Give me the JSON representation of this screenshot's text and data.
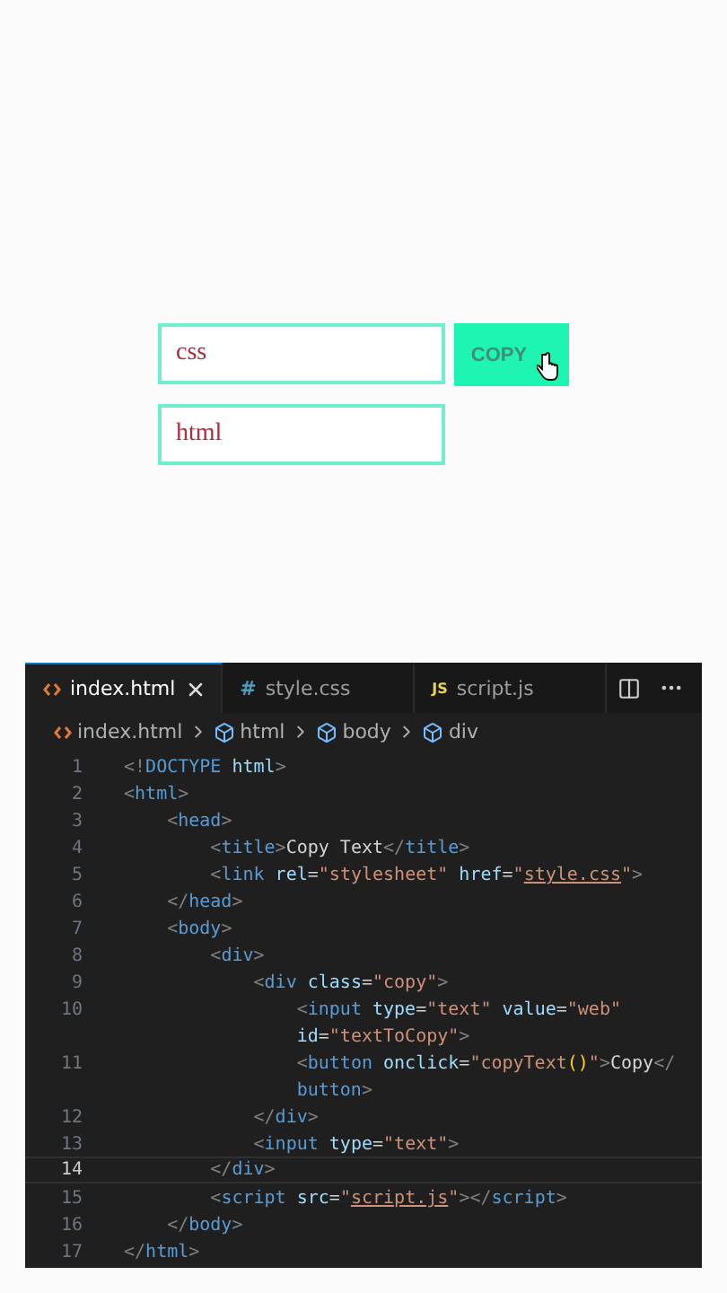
{
  "preview": {
    "inputs": [
      {
        "value": "css"
      },
      {
        "value": "html"
      }
    ],
    "button": {
      "label": "COPY"
    }
  },
  "editor": {
    "tabs": [
      {
        "label": "index.html",
        "kind": "html",
        "selected": true,
        "closable": true
      },
      {
        "label": "style.css",
        "kind": "css",
        "badge": "#",
        "selected": false,
        "closable": false
      },
      {
        "label": "script.js",
        "kind": "js",
        "badge": "JS",
        "selected": false,
        "closable": false
      }
    ],
    "breadcrumbs": [
      {
        "label": "index.html",
        "kind": "file"
      },
      {
        "label": "html",
        "kind": "element"
      },
      {
        "label": "body",
        "kind": "element"
      },
      {
        "label": "div",
        "kind": "element"
      }
    ],
    "lines": [
      {
        "number": "1",
        "current": false,
        "rows": [
          {
            "tokens": [
              {
                "kind": "punct",
                "text": "<!"
              },
              {
                "kind": "tag",
                "text": "DOCTYPE"
              },
              {
                "kind": "attr",
                "text": " html"
              },
              {
                "kind": "punct",
                "text": ">"
              }
            ]
          }
        ]
      },
      {
        "number": "2",
        "current": false,
        "rows": [
          {
            "tokens": [
              {
                "kind": "punct",
                "text": "<"
              },
              {
                "kind": "tag",
                "text": "html"
              },
              {
                "kind": "punct",
                "text": ">"
              }
            ]
          }
        ]
      },
      {
        "number": "3",
        "current": false,
        "rows": [
          {
            "tokens": [
              {
                "kind": "punct",
                "text": "    <"
              },
              {
                "kind": "tag",
                "text": "head"
              },
              {
                "kind": "punct",
                "text": ">"
              }
            ]
          }
        ]
      },
      {
        "number": "4",
        "current": false,
        "rows": [
          {
            "tokens": [
              {
                "kind": "punct",
                "text": "        <"
              },
              {
                "kind": "tag",
                "text": "title"
              },
              {
                "kind": "punct",
                "text": ">"
              },
              {
                "kind": "plain",
                "text": "Copy Text"
              },
              {
                "kind": "punct",
                "text": "</"
              },
              {
                "kind": "tag",
                "text": "title"
              },
              {
                "kind": "punct",
                "text": ">"
              }
            ]
          }
        ]
      },
      {
        "number": "5",
        "current": false,
        "rows": [
          {
            "tokens": [
              {
                "kind": "punct",
                "text": "        <"
              },
              {
                "kind": "tag",
                "text": "link"
              },
              {
                "kind": "attr",
                "text": " rel"
              },
              {
                "kind": "plain",
                "text": "="
              },
              {
                "kind": "string",
                "text": "\"stylesheet\""
              },
              {
                "kind": "attr",
                "text": " href"
              },
              {
                "kind": "plain",
                "text": "="
              },
              {
                "kind": "string",
                "text": "\""
              },
              {
                "kind": "link",
                "text": "style.css"
              },
              {
                "kind": "string",
                "text": "\""
              },
              {
                "kind": "punct",
                "text": ">"
              }
            ]
          }
        ]
      },
      {
        "number": "6",
        "current": false,
        "rows": [
          {
            "tokens": [
              {
                "kind": "punct",
                "text": "    </"
              },
              {
                "kind": "tag",
                "text": "head"
              },
              {
                "kind": "punct",
                "text": ">"
              }
            ]
          }
        ]
      },
      {
        "number": "7",
        "current": false,
        "rows": [
          {
            "tokens": [
              {
                "kind": "punct",
                "text": "    <"
              },
              {
                "kind": "tag",
                "text": "body"
              },
              {
                "kind": "punct",
                "text": ">"
              }
            ]
          }
        ]
      },
      {
        "number": "8",
        "current": false,
        "rows": [
          {
            "tokens": [
              {
                "kind": "punct",
                "text": "        <"
              },
              {
                "kind": "tag",
                "text": "div"
              },
              {
                "kind": "punct",
                "text": ">"
              }
            ]
          }
        ]
      },
      {
        "number": "9",
        "current": false,
        "rows": [
          {
            "tokens": [
              {
                "kind": "punct",
                "text": "            <"
              },
              {
                "kind": "tag",
                "text": "div"
              },
              {
                "kind": "attr",
                "text": " class"
              },
              {
                "kind": "plain",
                "text": "="
              },
              {
                "kind": "string",
                "text": "\"copy\""
              },
              {
                "kind": "punct",
                "text": ">"
              }
            ]
          }
        ]
      },
      {
        "number": "10",
        "current": false,
        "rows": [
          {
            "tokens": [
              {
                "kind": "punct",
                "text": "                <"
              },
              {
                "kind": "tag",
                "text": "input"
              },
              {
                "kind": "attr",
                "text": " type"
              },
              {
                "kind": "plain",
                "text": "="
              },
              {
                "kind": "string",
                "text": "\"text\""
              },
              {
                "kind": "attr",
                "text": " value"
              },
              {
                "kind": "plain",
                "text": "="
              },
              {
                "kind": "string",
                "text": "\"web\""
              }
            ]
          },
          {
            "tokens": [
              {
                "kind": "attr",
                "text": "                id"
              },
              {
                "kind": "plain",
                "text": "="
              },
              {
                "kind": "string",
                "text": "\"textToCopy\""
              },
              {
                "kind": "punct",
                "text": ">"
              }
            ]
          }
        ]
      },
      {
        "number": "11",
        "current": false,
        "rows": [
          {
            "tokens": [
              {
                "kind": "punct",
                "text": "                <"
              },
              {
                "kind": "tag",
                "text": "button"
              },
              {
                "kind": "attr",
                "text": " onclick"
              },
              {
                "kind": "plain",
                "text": "="
              },
              {
                "kind": "string",
                "text": "\"copyText"
              },
              {
                "kind": "paren",
                "text": "()"
              },
              {
                "kind": "string",
                "text": "\""
              },
              {
                "kind": "punct",
                "text": ">"
              },
              {
                "kind": "plain",
                "text": "Copy"
              },
              {
                "kind": "punct",
                "text": "</"
              }
            ]
          },
          {
            "tokens": [
              {
                "kind": "tag",
                "text": "                button"
              },
              {
                "kind": "punct",
                "text": ">"
              }
            ]
          }
        ]
      },
      {
        "number": "12",
        "current": false,
        "rows": [
          {
            "tokens": [
              {
                "kind": "punct",
                "text": "            </"
              },
              {
                "kind": "tag",
                "text": "div"
              },
              {
                "kind": "punct",
                "text": ">"
              }
            ]
          }
        ]
      },
      {
        "number": "13",
        "current": false,
        "rows": [
          {
            "tokens": [
              {
                "kind": "punct",
                "text": "            <"
              },
              {
                "kind": "tag",
                "text": "input"
              },
              {
                "kind": "attr",
                "text": " type"
              },
              {
                "kind": "plain",
                "text": "="
              },
              {
                "kind": "string",
                "text": "\"text\""
              },
              {
                "kind": "punct",
                "text": ">"
              }
            ]
          }
        ]
      },
      {
        "number": "14",
        "current": true,
        "rows": [
          {
            "tokens": [
              {
                "kind": "punct",
                "text": "        </"
              },
              {
                "kind": "tag",
                "text": "div"
              },
              {
                "kind": "punct",
                "text": ">"
              }
            ]
          }
        ]
      },
      {
        "number": "15",
        "current": false,
        "rows": [
          {
            "tokens": [
              {
                "kind": "punct",
                "text": "        <"
              },
              {
                "kind": "tag",
                "text": "script"
              },
              {
                "kind": "attr",
                "text": " src"
              },
              {
                "kind": "plain",
                "text": "="
              },
              {
                "kind": "string",
                "text": "\""
              },
              {
                "kind": "link",
                "text": "script.js"
              },
              {
                "kind": "string",
                "text": "\""
              },
              {
                "kind": "punct",
                "text": "></"
              },
              {
                "kind": "tag",
                "text": "script"
              },
              {
                "kind": "punct",
                "text": ">"
              }
            ]
          }
        ]
      },
      {
        "number": "16",
        "current": false,
        "rows": [
          {
            "tokens": [
              {
                "kind": "punct",
                "text": "    </"
              },
              {
                "kind": "tag",
                "text": "body"
              },
              {
                "kind": "punct",
                "text": ">"
              }
            ]
          }
        ]
      },
      {
        "number": "17",
        "current": false,
        "rows": [
          {
            "tokens": [
              {
                "kind": "punct",
                "text": "</"
              },
              {
                "kind": "tag",
                "text": "html"
              },
              {
                "kind": "punct",
                "text": ">"
              }
            ]
          }
        ]
      }
    ]
  }
}
